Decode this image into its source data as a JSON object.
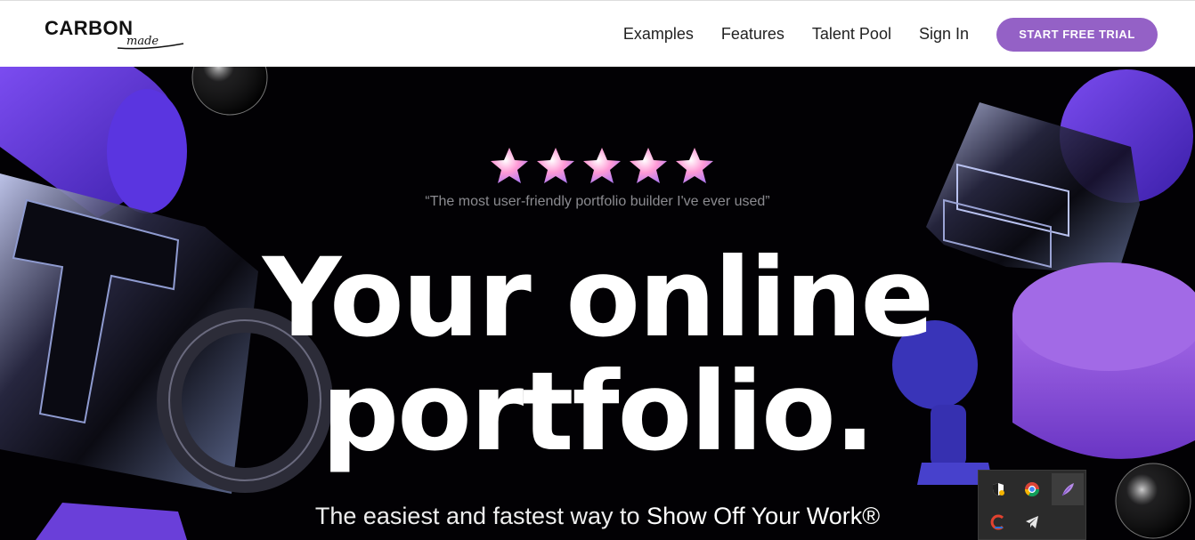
{
  "header": {
    "logo_main": "CARBON",
    "logo_sub": "made",
    "nav": [
      "Examples",
      "Features",
      "Talent Pool",
      "Sign In"
    ],
    "cta_label": "START FREE TRIAL"
  },
  "hero": {
    "rating": 5,
    "quote": "“The most user-friendly portfolio builder I've ever used”",
    "headline_line1": "Your online",
    "headline_line2": "portfolio.",
    "subline_prefix": "The easiest and fastest way to ",
    "subline_emphasis": "Show Off Your Work®"
  },
  "tray": {
    "icons": [
      "security-shield-icon",
      "chrome-icon",
      "feather-icon",
      "ccleaner-icon",
      "telegram-icon"
    ]
  },
  "colors": {
    "accent": "#9461c6",
    "purple": "#6a3fd9",
    "background": "#020104"
  }
}
